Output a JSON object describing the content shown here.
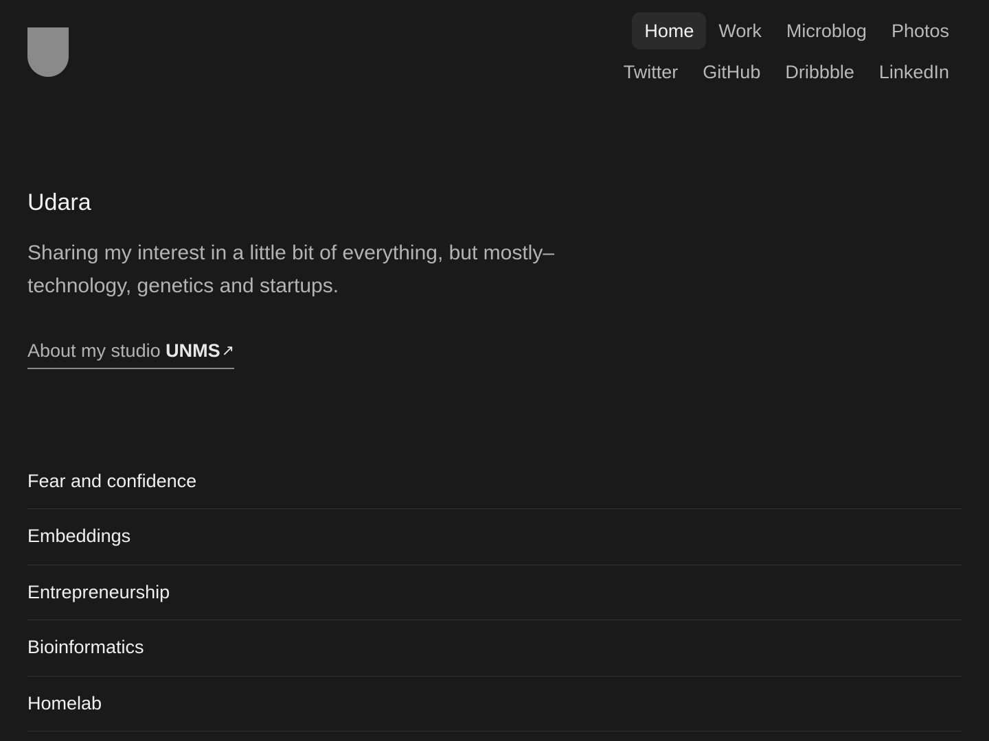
{
  "nav": {
    "primary": [
      {
        "label": "Home",
        "active": true
      },
      {
        "label": "Work"
      },
      {
        "label": "Microblog"
      },
      {
        "label": "Photos"
      }
    ],
    "social": [
      {
        "label": "Twitter"
      },
      {
        "label": "GitHub"
      },
      {
        "label": "Dribbble"
      },
      {
        "label": "LinkedIn"
      }
    ]
  },
  "intro": {
    "name": "Udara",
    "tagline": "Sharing my interest in a little bit of everything, but mostly– technology, genetics and startups."
  },
  "studio": {
    "prefix": "About my studio ",
    "name": "UNMS",
    "icon": "arrow-up-right-icon"
  },
  "posts": [
    "Fear and confidence",
    "Embeddings",
    "Entrepreneurship",
    "Bioinformatics",
    "Homelab"
  ],
  "colors": {
    "background": "#1b1a1b",
    "logo": "#8a8a8a",
    "active_nav_bg": "#2c2b2c"
  }
}
